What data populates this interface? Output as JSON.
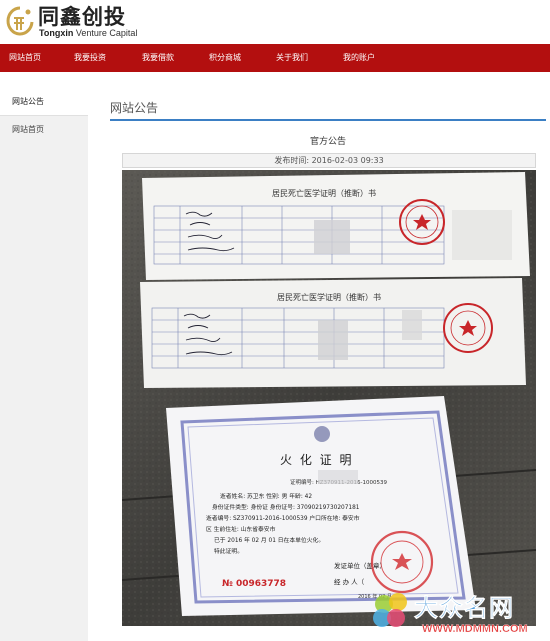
{
  "brand": {
    "name_cn": "同鑫创投",
    "name_en_bold": "Tongxin",
    "name_en_rest": " Venture Capital"
  },
  "nav": {
    "items": [
      {
        "label": "网站首页"
      },
      {
        "label": "我要投资"
      },
      {
        "label": "我要借款"
      },
      {
        "label": "积分商城"
      },
      {
        "label": "关于我们"
      },
      {
        "label": "我的账户"
      }
    ]
  },
  "sidebar": {
    "items": [
      {
        "label": "网站公告",
        "active": true
      },
      {
        "label": "网站首页",
        "active": false
      }
    ]
  },
  "main": {
    "section_title": "网站公告",
    "notice_title": "官方公告",
    "publish_time": "发布时间: 2016-02-03 09:33"
  },
  "photo": {
    "cert_top_title": "居民死亡医学证明（推断）书",
    "cert_mid_title": "居民死亡医学证明（推断）书",
    "cremation_title": "火 化 证 明",
    "cremation_no_label": "证明编号: HZ370911-2016-1000539",
    "cremation_lines": [
      "逝者姓名: 苏卫东  性别: 男  年龄: 42",
      "身份证件类型: 身份证  身份证号: 37090219730207181",
      "逝者编号: SZ370911-2016-1000539  户口所在地: 泰安市",
      "区  生前住址: 山东省泰安市",
      "已于 2016 年 02 月 01 日在本单位火化。",
      "特此证明。"
    ],
    "issuer_label": "发证单位（盖章）",
    "handler_label": "经 办 人（",
    "serial_no": "№ 00963778",
    "date_text": "2016 年 02 月"
  },
  "watermark": {
    "text_cn": "大众名网",
    "text_en": "WWW.MDMMN.COM"
  },
  "colors": {
    "nav_bg": "#b30f0f",
    "accent_rule": "#3b7fc4",
    "sidebar_bg": "#f1f1f1",
    "stamp_red": "#c8262a"
  }
}
